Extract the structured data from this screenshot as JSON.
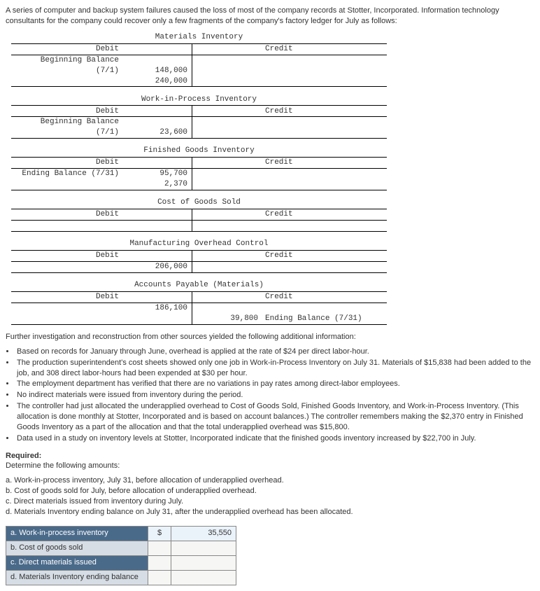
{
  "intro": "A series of computer and backup system failures caused the loss of most of the company records at Stotter, Incorporated. Information technology consultants for the company could recover only a few fragments of the company's factory ledger for July as follows:",
  "ledgers": {
    "debit": "Debit",
    "credit": "Credit",
    "materials": {
      "title": "Materials Inventory",
      "row1_label": "Beginning Balance (7/1)",
      "row1_value": "148,000",
      "row2_value": "240,000"
    },
    "wip": {
      "title": "Work-in-Process Inventory",
      "row1_label": "Beginning Balance (7/1)",
      "row1_value": "23,600"
    },
    "fg": {
      "title": "Finished Goods Inventory",
      "row1_label": "Ending Balance (7/31)",
      "row1_value": "95,700",
      "row2_value": "2,370"
    },
    "cogs": {
      "title": "Cost of Goods Sold"
    },
    "moh": {
      "title": "Manufacturing Overhead Control",
      "row1_value": "206,000"
    },
    "ap": {
      "title": "Accounts Payable (Materials)",
      "row1_value": "186,100",
      "row2_credit_value": "39,800",
      "row2_credit_label": "Ending Balance (7/31)"
    }
  },
  "further_text": "Further investigation and reconstruction from other sources yielded the following additional information:",
  "bullets": [
    "Based on records for January through June, overhead is applied at the rate of $24 per direct labor-hour.",
    "The production superintendent's cost sheets showed only one job in Work-in-Process Inventory on July 31. Materials of $15,838 had been added to the job, and 308 direct labor-hours had been expended at $30 per hour.",
    "The employment department has verified that there are no variations in pay rates among direct-labor employees.",
    "No indirect materials were issued from inventory during the period.",
    "The controller had just allocated the underapplied overhead to Cost of Goods Sold, Finished Goods Inventory, and Work-in-Process Inventory. (This allocation is done monthly at Stotter, Incorporated and is based on account balances.) The controller remembers making the $2,370 entry in Finished Goods Inventory as a part of the allocation and that the total underapplied overhead was $15,800.",
    "Data used in a study on inventory levels at Stotter, Incorporated indicate that the finished goods inventory increased by $22,700 in July."
  ],
  "required": {
    "heading": "Required:",
    "subtext": "Determine the following amounts:",
    "items": [
      "a. Work-in-process inventory, July 31, before allocation of underapplied overhead.",
      "b. Cost of goods sold for July, before allocation of underapplied overhead.",
      "c. Direct materials issued from inventory during July.",
      "d. Materials Inventory ending balance on July 31, after the underapplied overhead has been allocated."
    ]
  },
  "answers": {
    "a_label": "a. Work-in-process inventory",
    "b_label": "b. Cost of goods sold",
    "c_label": "c. Direct materials issued",
    "d_label": "d. Materials Inventory ending balance",
    "dollar": "$",
    "a_value": "35,550"
  }
}
